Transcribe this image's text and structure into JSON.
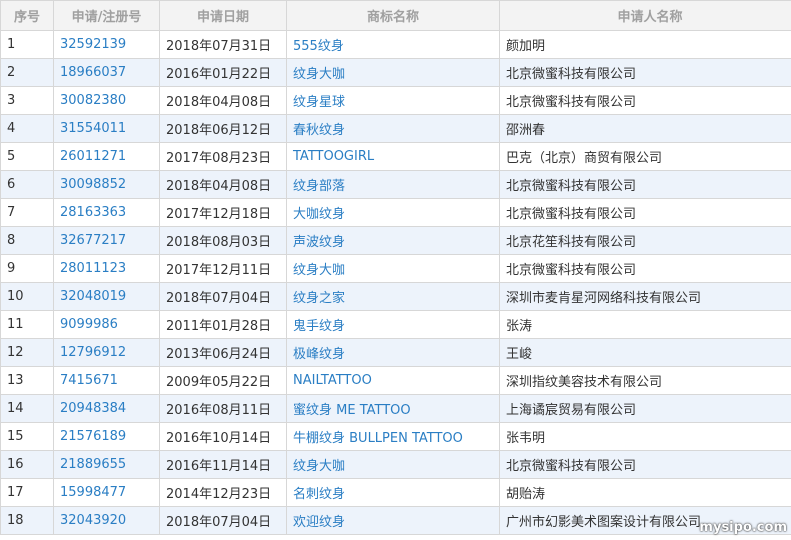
{
  "table": {
    "headers": {
      "index": "序号",
      "reg_no": "申请/注册号",
      "date": "申请日期",
      "mark_name": "商标名称",
      "applicant": "申请人名称"
    },
    "rows": [
      {
        "index": "1",
        "reg_no": "32592139",
        "date": "2018年07月31日",
        "mark": "555纹身",
        "applicant": "颜加明"
      },
      {
        "index": "2",
        "reg_no": "18966037",
        "date": "2016年01月22日",
        "mark": "纹身大咖",
        "applicant": "北京微蜜科技有限公司"
      },
      {
        "index": "3",
        "reg_no": "30082380",
        "date": "2018年04月08日",
        "mark": "纹身星球",
        "applicant": "北京微蜜科技有限公司"
      },
      {
        "index": "4",
        "reg_no": "31554011",
        "date": "2018年06月12日",
        "mark": "春秋纹身",
        "applicant": "邵洲春"
      },
      {
        "index": "5",
        "reg_no": "26011271",
        "date": "2017年08月23日",
        "mark": "TATTOOGIRL",
        "applicant": "巴克（北京）商贸有限公司"
      },
      {
        "index": "6",
        "reg_no": "30098852",
        "date": "2018年04月08日",
        "mark": "纹身部落",
        "applicant": "北京微蜜科技有限公司"
      },
      {
        "index": "7",
        "reg_no": "28163363",
        "date": "2017年12月18日",
        "mark": "大咖纹身",
        "applicant": "北京微蜜科技有限公司"
      },
      {
        "index": "8",
        "reg_no": "32677217",
        "date": "2018年08月03日",
        "mark": "声波纹身",
        "applicant": "北京花笙科技有限公司"
      },
      {
        "index": "9",
        "reg_no": "28011123",
        "date": "2017年12月11日",
        "mark": "纹身大咖",
        "applicant": "北京微蜜科技有限公司"
      },
      {
        "index": "10",
        "reg_no": "32048019",
        "date": "2018年07月04日",
        "mark": "纹身之家",
        "applicant": "深圳市麦肯星河网络科技有限公司"
      },
      {
        "index": "11",
        "reg_no": "9099986",
        "date": "2011年01月28日",
        "mark": "鬼手纹身",
        "applicant": "张涛"
      },
      {
        "index": "12",
        "reg_no": "12796912",
        "date": "2013年06月24日",
        "mark": "极峰纹身",
        "applicant": "王峻"
      },
      {
        "index": "13",
        "reg_no": "7415671",
        "date": "2009年05月22日",
        "mark": "NAILTATTOO",
        "applicant": "深圳指纹美容技术有限公司"
      },
      {
        "index": "14",
        "reg_no": "20948384",
        "date": "2016年08月11日",
        "mark": "蜜纹身 ME TATTOO",
        "applicant": "上海谲宸贸易有限公司"
      },
      {
        "index": "15",
        "reg_no": "21576189",
        "date": "2016年10月14日",
        "mark": "牛棚纹身 BULLPEN TATTOO",
        "applicant": "张韦明"
      },
      {
        "index": "16",
        "reg_no": "21889655",
        "date": "2016年11月14日",
        "mark": "纹身大咖",
        "applicant": "北京微蜜科技有限公司"
      },
      {
        "index": "17",
        "reg_no": "15998477",
        "date": "2014年12月23日",
        "mark": "名刺纹身",
        "applicant": "胡贻涛"
      },
      {
        "index": "18",
        "reg_no": "32043920",
        "date": "2018年07月04日",
        "mark": "欢迎纹身",
        "applicant": "广州市幻影美术图案设计有限公司"
      }
    ]
  },
  "watermark": "mysipo.com",
  "colors": {
    "link": "#2a7ec4",
    "header_bg": "#f3f3f3",
    "header_text": "#a0a0a0",
    "stripe_bg": "#edf3fb",
    "border": "#d7d7d7"
  }
}
